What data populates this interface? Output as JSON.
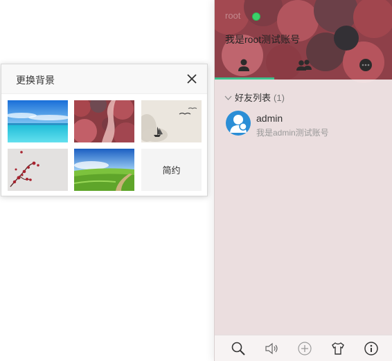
{
  "skin_popup": {
    "title": "更换背景",
    "plain_label": "简约",
    "thumbnails": [
      {
        "name": "sea-sky"
      },
      {
        "name": "red-forest"
      },
      {
        "name": "ink-painting"
      },
      {
        "name": "plum-blossom"
      },
      {
        "name": "green-field"
      }
    ]
  },
  "panel": {
    "user": {
      "name": "root",
      "status": "online",
      "sign": "我是root测试账号"
    },
    "tabs": [
      {
        "label": "friends",
        "icon": "person-icon",
        "active": true
      },
      {
        "label": "groups",
        "icon": "group-icon",
        "active": false
      },
      {
        "label": "history",
        "icon": "chat-icon",
        "active": false
      }
    ],
    "groups": [
      {
        "label": "好友列表",
        "count": "(1)",
        "friends": [
          {
            "name": "admin",
            "sign": "我是admin测试账号"
          }
        ]
      }
    ],
    "toolbar": [
      {
        "icon": "search-icon"
      },
      {
        "icon": "speaker-icon"
      },
      {
        "icon": "plus-icon"
      },
      {
        "icon": "skin-shirt-icon"
      },
      {
        "icon": "info-icon"
      }
    ]
  },
  "colors": {
    "accent": "#3cc28d",
    "online": "#3bd26a",
    "avatar": "#2b8ed6"
  }
}
